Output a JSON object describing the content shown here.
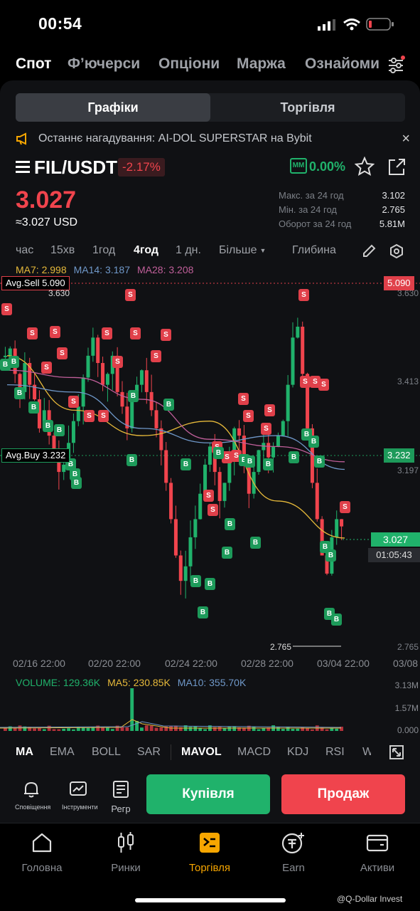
{
  "status": {
    "time": "00:54"
  },
  "top_tabs": [
    "Спот",
    "Ф’ючерси",
    "Опціони",
    "Маржа",
    "Ознайоми"
  ],
  "segment": {
    "left": "Графіки",
    "right": "Торгівля"
  },
  "announcement": "Останнє нагадування: AI-DOL SUPERSTAR на Bybit",
  "pair": {
    "name": "FIL/USDT",
    "change": "-2.17%",
    "mm_badge": "MM",
    "mm_value": "0.00%"
  },
  "price": {
    "last": "3.027",
    "usd": "≈3.027 USD"
  },
  "stats": [
    {
      "label": "Макс. за 24 год",
      "value": "3.102"
    },
    {
      "label": "Мін. за 24 год",
      "value": "2.765"
    },
    {
      "label": "Оборот за 24 год",
      "value": "5.81M"
    }
  ],
  "timeframes": [
    "час",
    "15хв",
    "1год",
    "4год",
    "1 дн.",
    "Більше",
    "Глибина"
  ],
  "active_timeframe": "4год",
  "ma_legend": {
    "ma7": "MA7: 2.998",
    "ma14": "MA14: 3.187",
    "ma28": "MA28: 3.208"
  },
  "chart": {
    "avg_sell": "Avg.Sell 5.090",
    "avg_sell_value": "5.090",
    "avg_buy": "Avg.Buy 3.232",
    "avg_buy_value": "3.232",
    "current_price": "3.027",
    "countdown": "01:05:43",
    "high_label": "3.630",
    "low_label": "2.765",
    "y_ticks": [
      "3.630",
      "3.413",
      "3.197",
      "2.765"
    ],
    "x_ticks": [
      "02/16 22:00",
      "02/20 22:00",
      "02/24 22:00",
      "02/28 22:00",
      "03/04 22:00",
      "03/08"
    ],
    "badge_s": "S",
    "badge_b": "B"
  },
  "chart_data": {
    "type": "line",
    "title": "",
    "ylim": [
      2.765,
      3.63
    ],
    "x": [
      "02/16 22:00",
      "02/20 22:00",
      "02/24 22:00",
      "02/28 22:00",
      "03/04 22:00",
      "03/08"
    ],
    "series": [
      {
        "name": "MA7",
        "values": [
          3.5,
          3.35,
          3.28,
          3.32,
          3.1,
          2.998
        ]
      },
      {
        "name": "MA14",
        "values": [
          3.42,
          3.4,
          3.3,
          3.26,
          3.28,
          3.187
        ]
      },
      {
        "name": "MA28",
        "values": [
          3.46,
          3.44,
          3.38,
          3.27,
          3.25,
          3.208
        ]
      }
    ]
  },
  "volume": {
    "label": "VOLUME: 129.36K",
    "ma5": "MA5: 230.85K",
    "ma10": "MA10: 355.70K",
    "y_ticks": [
      "3.13M",
      "1.57M",
      "0.000"
    ]
  },
  "indicators": [
    "MA",
    "EMA",
    "BOLL",
    "SAR",
    "MAVOL",
    "MACD",
    "KDJ",
    "RSI",
    "W"
  ],
  "actions": {
    "alerts": "Сповіщення",
    "tools": "Інструменти",
    "regr": "Регр",
    "buy": "Купівля",
    "sell": "Продаж"
  },
  "nav": [
    "Головна",
    "Ринки",
    "Торгівля",
    "Earn",
    "Активи"
  ],
  "watermark": "@Q-Dollar Invest",
  "colors": {
    "up": "#20b26b",
    "down": "#f0444d",
    "accent": "#f7a600",
    "ma7": "#e6b93a",
    "ma14": "#6f98c9",
    "ma28": "#c05f9a"
  }
}
